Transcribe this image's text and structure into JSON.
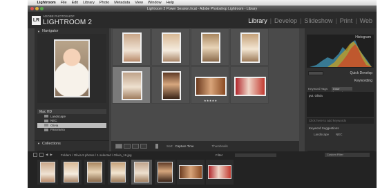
{
  "menubar": {
    "items": [
      "Lightroom",
      "File",
      "Edit",
      "Library",
      "Photo",
      "Metadata",
      "View",
      "Window",
      "Help"
    ]
  },
  "window": {
    "title": "Lightroom 2 Power Session.lrcat - Adobe Photoshop Lightroom - Library"
  },
  "identity": {
    "badge": "LR",
    "adobe_label": "ADOBE PHOTOSHOP",
    "product_name": "LIGHTROOM 2"
  },
  "modules": {
    "library": "Library",
    "develop": "Develop",
    "slideshow": "Slideshow",
    "print": "Print",
    "web": "Web",
    "separator": "|"
  },
  "left_panel": {
    "navigator_title": "Navigator",
    "volume_label": "Mac HD",
    "folders": [
      "Landscape",
      "NEC",
      "Olivia",
      "Panorama"
    ],
    "selected_folder": 2,
    "collections_title": "Collections",
    "import_label": "Import...",
    "export_label": "Export..."
  },
  "grid": {
    "rating_stars": "★★★★★"
  },
  "toolbar": {
    "sort_label": "Sort:",
    "sort_value": "Capture Time",
    "thumbnails_label": "Thumbnails"
  },
  "right_panel": {
    "histogram_title": "Histogram",
    "quick_develop_title": "Quick Develop",
    "keywording_title": "Keywording",
    "keyword_tags_label": "Keyword Tags",
    "keyword_tags_mode": "Enter Keywords",
    "keyword_text": "pvt. Olivia",
    "add_placeholder": "Click here to add keywords",
    "suggestions_title": "Keyword Suggestions",
    "suggestions": [
      "Landscape",
      "NEC"
    ],
    "sync_metadata_label": "Sync Metadata",
    "sync_settings_label": "Sync Settings"
  },
  "filmstrip": {
    "info": "Folders / Olivia   9 photos / 1 selected / Olivia_16.jpg",
    "filter_label": "Filter:",
    "custom_filter": "Custom Filter"
  },
  "colors": {
    "panel_bg": "#2f2f2f",
    "grid_bg": "#4a4a4a",
    "active_module": "#f0f0f0",
    "selected_folder_bg": "#bdbdbd"
  }
}
